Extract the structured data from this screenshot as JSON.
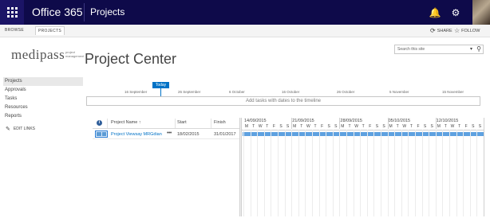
{
  "suite_bar": {
    "brand": "Office 365",
    "app_title": "Projects",
    "icons": [
      "waffle-icon",
      "bell-icon",
      "gear-icon",
      "help-icon",
      "avatar"
    ]
  },
  "ribbon": {
    "tabs": [
      "BROWSE",
      "PROJECTS"
    ],
    "active_tab": "PROJECTS",
    "share_label": "SHARE",
    "follow_label": "FOLLOW"
  },
  "site": {
    "logo": "medipass",
    "logo_tagline": "project management",
    "page_title": "Project Center"
  },
  "search": {
    "placeholder": "Search this site"
  },
  "nav": {
    "items": [
      "Projects",
      "Approvals",
      "Tasks",
      "Resources",
      "Reports"
    ],
    "selected": "Projects",
    "edit_links": "EDIT LINKS"
  },
  "timeline": {
    "today_label": "Today",
    "dates": [
      "16 September",
      "26 September",
      "6 October",
      "16 October",
      "26 October",
      "5 November",
      "15 November"
    ],
    "empty_message": "Add tasks with dates to the timeline"
  },
  "grid": {
    "columns": [
      "Project Name",
      "Start",
      "Finish"
    ],
    "sort_indicator": "↑",
    "rows": [
      {
        "name": "Project Viewsay MRGdian",
        "start": "18/02/2015",
        "finish": "31/01/2017"
      }
    ]
  },
  "gantt": {
    "weeks": [
      "14/09/2015",
      "21/09/2015",
      "28/09/2015",
      "05/10/2015",
      "12/10/2015"
    ],
    "days": [
      "M",
      "T",
      "W",
      "T",
      "F",
      "S",
      "S"
    ]
  },
  "colors": {
    "suite_bar": "#0e0a4a",
    "accent": "#0072c6",
    "gantt_bar": "#5ea1e0"
  }
}
